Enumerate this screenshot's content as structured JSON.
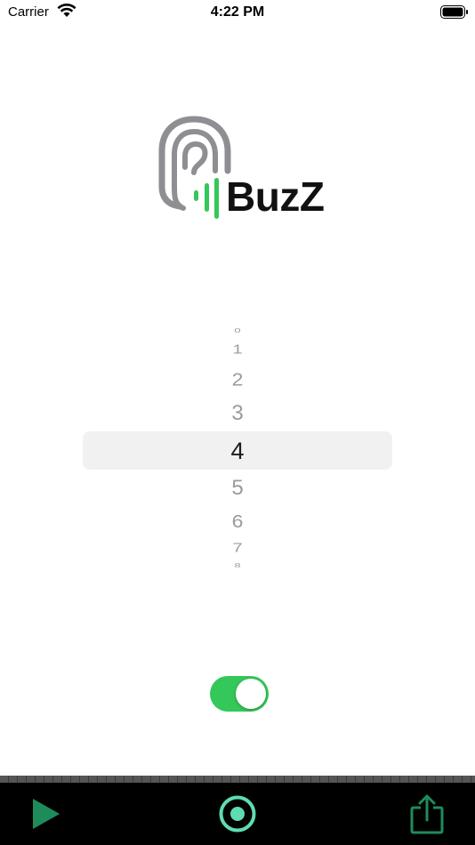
{
  "status_bar": {
    "carrier": "Carrier",
    "time": "4:22 PM",
    "icons": [
      "wifi-icon",
      "battery-icon"
    ]
  },
  "logo": {
    "text": "BuzZ",
    "icon": "ear-sound-icon",
    "colors": {
      "ear": "#8e8e93",
      "bars": "#34c759",
      "text": "#111111"
    }
  },
  "picker": {
    "items": [
      "0",
      "1",
      "2",
      "3",
      "4",
      "5",
      "6",
      "7",
      "8"
    ],
    "selected": "4"
  },
  "toggle": {
    "on": true,
    "color": "#34c759"
  },
  "toolbar": {
    "buttons": [
      "play-icon",
      "record-icon",
      "share-icon"
    ],
    "colors": {
      "play": "#1e8c5a",
      "record": "#5fdcb0",
      "share": "#1e8c5a"
    }
  }
}
